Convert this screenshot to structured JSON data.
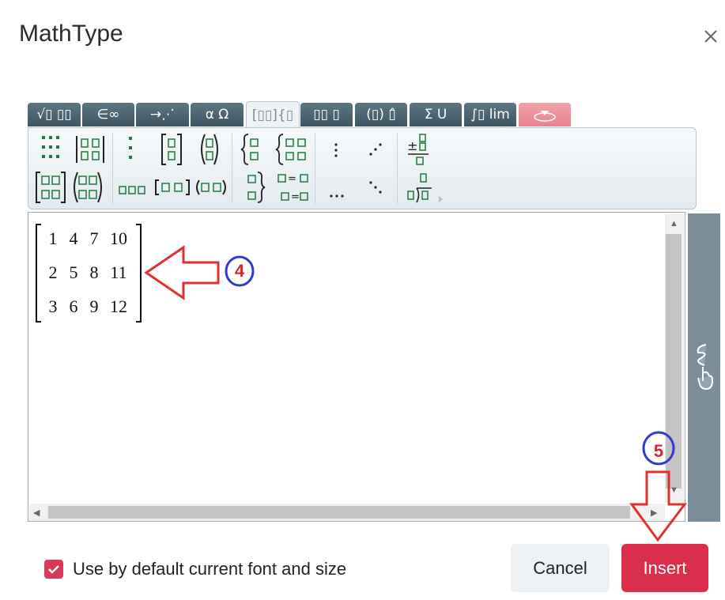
{
  "dialog": {
    "title": "MathType",
    "close_icon": "close-icon"
  },
  "tabs": [
    {
      "label": "√▯ ∷",
      "icon": "radical-fraction-tab"
    },
    {
      "label": "∈∞",
      "icon": "symbols-tab"
    },
    {
      "label": "→⋰",
      "icon": "arrows-tab"
    },
    {
      "label": "α Ω",
      "icon": "greek-tab"
    },
    {
      "label": "[∷]{∷",
      "icon": "matrix-tab",
      "active": true
    },
    {
      "label": "▯□ ▯",
      "icon": "scripts-tab"
    },
    {
      "label": "(▯) ▯̂",
      "icon": "brackets-tab"
    },
    {
      "label": "Σ U",
      "icon": "big-operators-tab"
    },
    {
      "label": "∫ lim",
      "icon": "calculus-tab"
    },
    {
      "label": "",
      "icon": "handwriting-tab"
    }
  ],
  "toolbar": {
    "row1": [
      "matrix-3x3-icon",
      "determinant-icon",
      "column-vector-icon",
      "bracket-matrix-icon",
      "paren-matrix-icon",
      "brace-left-icon",
      "brace-matrix-icon",
      "vertical-dots-icon",
      "diagonal-dots-icon",
      "plus-fraction-icon"
    ],
    "row2": [
      "bracket-2x2-icon",
      "paren-2x2-icon",
      "row-vector-icon",
      "bracket-row-icon",
      "paren-row-icon",
      "brace-right-icon",
      "equations-icon",
      "horizontal-dots-icon",
      "down-diagonal-dots-icon",
      "long-division-icon"
    ]
  },
  "matrix": {
    "rows": [
      [
        "1",
        "4",
        "7",
        "10"
      ],
      [
        "2",
        "5",
        "8",
        "11"
      ],
      [
        "3",
        "6",
        "9",
        "12"
      ]
    ]
  },
  "annotations": {
    "step4": "4",
    "step5": "5",
    "color": "#d6282b",
    "circle_color": "#2f3bd0"
  },
  "footer": {
    "checkbox_label": "Use by default current font and size",
    "checkbox_checked": true,
    "cancel_label": "Cancel",
    "insert_label": "Insert"
  },
  "colors": {
    "accent": "#d92f4c",
    "tab": "#4d6672",
    "toolbar_icon": "#1d7a3a"
  }
}
